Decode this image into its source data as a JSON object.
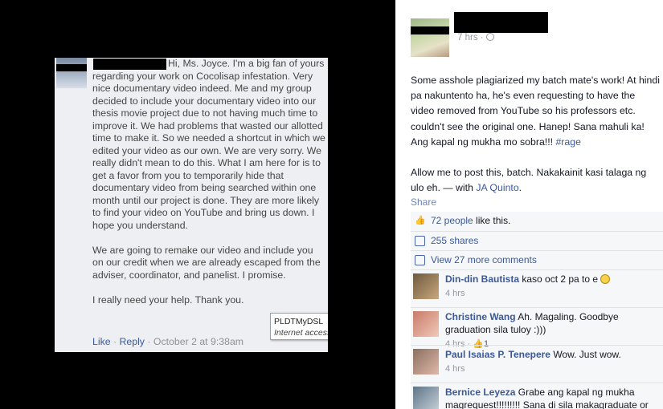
{
  "message": {
    "paragraphs": [
      "Hi, Ms. Joyce. I'm a big fan of yours regarding your work on Cocolisap infestation. Very nice documentary video indeed. Me and my group decided to include your documentary video into our thesis movie project due to not having much time to improve it. We had problems that wasted our allotted time to make it. So we needed a shortcut in which we edited your video as our own. We are very sorry. We really didn't mean to do this. What I am here for is to get a favor from you to temporarily hide that documentary video from being searched within one month until our project is done. They are more likely to find your video on YouTube and bring us down. I hope you understand.",
      "We are going to remake our video and include you on our credit when we are already escaped from the adviser, coordinator, and panelist. I promise.",
      "I really need your help. Thank you."
    ],
    "like_label": "Like",
    "separator": "·",
    "reply_label": "Reply",
    "timestamp": "October 2 at 9:38am",
    "tooltip_title": "PLDTMyDSL",
    "tooltip_sub": "Internet access"
  },
  "post": {
    "meta_time": "7 hrs",
    "meta_sep": "·",
    "body_p1": "Some asshole plagiarized my batch mate's work! At hindi pa nakuntento ha, he's even requesting to have the video removed from YouTube so his professors etc. couldn't see the original one. Hanep! Sana mahuli ka! Ang kapal ng mukha mo sobra!!!",
    "hashtag": "#rage",
    "body_p2": "Allow me to post this, batch. Nakakainit kasi talaga ng ulo eh. — with",
    "tagged": "JA Quinto",
    "body_p2_end": ".",
    "share_label": "Share",
    "likes_link": "72 people",
    "likes_rest": " like this.",
    "shares_label": "255 shares",
    "view_more_label": "View 27 more comments",
    "comments": [
      {
        "name": "Din-din Bautista",
        "text": "kaso oct 2 pa to e",
        "time": "4 hrs",
        "likes": "",
        "avatar_color": "#6e5a3e"
      },
      {
        "name": "Christine Wang",
        "text": "Ah. Magaling. Goodbye graduation sila tuloy :)))",
        "time": "4 hrs",
        "likes": "1",
        "avatar_color": "#c87a6a"
      },
      {
        "name": "Paul Isaias P. Tenepere",
        "text": "Wow. Just wow.",
        "time": "4 hrs",
        "likes": "",
        "avatar_color": "#8a6f60"
      },
      {
        "name": "Bernice Leyeza",
        "text": "Grabe ang kapal ng mukha magrequest!!!!!!!!! Sana di sila makagraduate or",
        "time": "",
        "likes": "",
        "avatar_color": "#5f7486"
      }
    ]
  },
  "colors": {
    "link": "#3b5998",
    "meta_gray": "#9197a3",
    "message_bg": "#eeeff2",
    "background": "#000000"
  },
  "icons": [
    "thumbs-up-icon",
    "share-icon",
    "comment-icon",
    "globe-icon",
    "smiley-icon"
  ]
}
